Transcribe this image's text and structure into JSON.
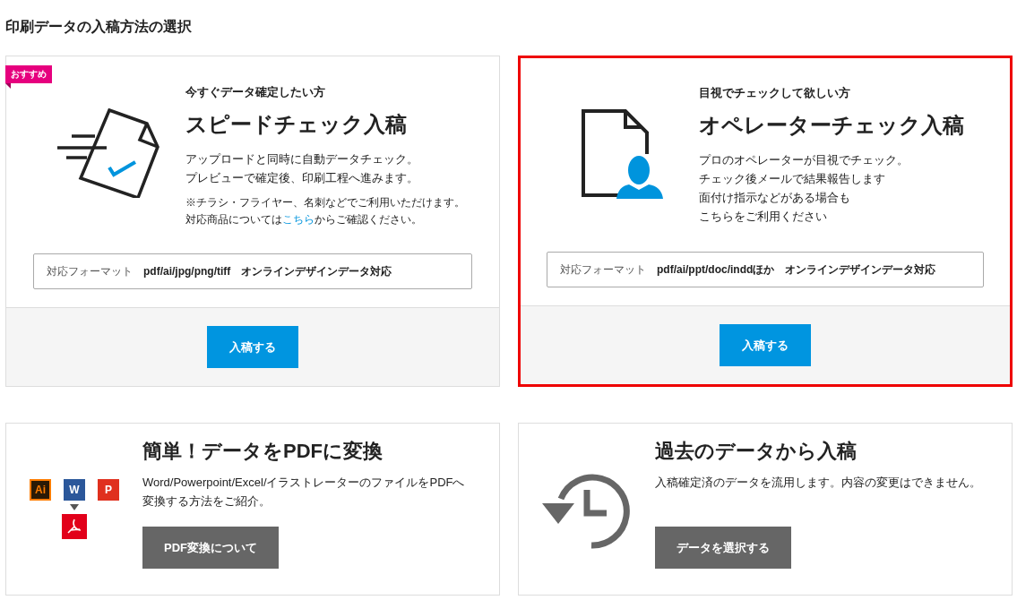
{
  "heading": "印刷データの入稿方法の選択",
  "methods": [
    {
      "kind": "speed",
      "selected": false,
      "badge": "おすすめ",
      "tagline": "今すぐデータ確定したい方",
      "title": "スピードチェック入稿",
      "description": [
        "アップロードと同時に自動データチェック。",
        "プレビューで確定後、印刷工程へ進みます。"
      ],
      "note": {
        "line": "※チラシ・フライヤー、名刺などでご利用いただけます。",
        "before": "対応商品については",
        "link": "こちら",
        "after": "からご確認ください。"
      },
      "format": {
        "label": "対応フォーマット",
        "types": "pdf/ai/jpg/png/tiff",
        "extra": "オンラインデザインデータ対応"
      },
      "button": "入稿する"
    },
    {
      "kind": "operator",
      "selected": true,
      "tagline": "目視でチェックして欲しい方",
      "title": "オペレーターチェック入稿",
      "description": [
        "プロのオペレーターが目視でチェック。",
        "チェック後メールで結果報告します",
        "面付け指示などがある場合も",
        "こちらをご利用ください"
      ],
      "format": {
        "label": "対応フォーマット",
        "types": "pdf/ai/ppt/doc/inddほか",
        "extra": "オンラインデザインデータ対応"
      },
      "button": "入稿する"
    }
  ],
  "tools": [
    {
      "kind": "pdf",
      "title": "簡単！データをPDFに変換",
      "description": "Word/Powerpoint/Excel/イラストレーターのファイルをPDFへ変換する方法をご紹介。",
      "app_icons": [
        {
          "kind": "illustrator",
          "label": "Ai"
        },
        {
          "kind": "word",
          "label": "W"
        },
        {
          "kind": "powerpoint",
          "label": "P"
        }
      ],
      "button": "PDF変換について"
    },
    {
      "kind": "history",
      "title": "過去のデータから入稿",
      "description": "入稿確定済のデータを流用します。内容の変更はできません。",
      "button": "データを選択する"
    }
  ]
}
